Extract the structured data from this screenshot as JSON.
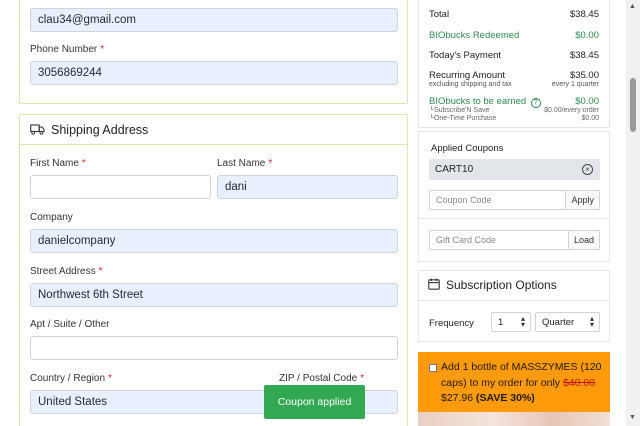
{
  "contact": {
    "email_value": "clau34@gmail.com",
    "phone_label": "Phone Number",
    "phone_value": "3056869244"
  },
  "shipping": {
    "title": "Shipping Address",
    "first_name_label": "First Name",
    "first_name_value": "",
    "last_name_label": "Last Name",
    "last_name_value": "dani",
    "company_label": "Company",
    "company_value": "danielcompany",
    "street_label": "Street Address",
    "street_value": "Northwest 6th Street",
    "apt_label": "Apt / Suite / Other",
    "apt_value": "",
    "country_label": "Country / Region",
    "country_value": "United States",
    "zip_label": "ZIP / Postal Code",
    "required_mark": "*"
  },
  "summary": {
    "total_label": "Total",
    "total_value": "$38.45",
    "redeemed_label": "BIObucks Redeemed",
    "redeemed_value": "$0.00",
    "today_label": "Today's Payment",
    "today_value": "$38.45",
    "recurring_label": "Recurring Amount",
    "recurring_value": "$35.00",
    "recurring_note": "excluding shipping and tax",
    "recurring_freq": "every 1 quarter",
    "earned_label": "BIObucks to be earned",
    "earned_value": "$0.00",
    "subscribe_label": "└Subscribe'N Save",
    "subscribe_value": "$0.00/every order",
    "onetime_label": "└One-Time Purchase",
    "onetime_value": "$0.00",
    "help_glyph": "?"
  },
  "coupons": {
    "title": "Applied Coupons",
    "applied": "CART10",
    "remove_glyph": "×",
    "coupon_placeholder": "Coupon Code",
    "apply_label": "Apply",
    "gift_placeholder": "Gift Card Code",
    "load_label": "Load"
  },
  "subscription": {
    "title": "Subscription Options",
    "frequency_label": "Frequency",
    "quantity_value": "1",
    "period_value": "Quarter"
  },
  "promo": {
    "text_a": "Add 1 bottle of MASSZYMES (120 caps) to my order for only ",
    "old_price": "$40.00",
    "new_price": " $27.96 ",
    "save": "(SAVE 30%)"
  },
  "toast": {
    "message": "Coupon applied"
  },
  "colors": {
    "accent_green": "#2c8a4d",
    "promo_orange": "#ff9a0a",
    "toast_green": "#32a852",
    "field_fill": "#e9f0fd"
  },
  "icons": {
    "shipping": "truck-icon",
    "subscription": "calendar-icon"
  }
}
